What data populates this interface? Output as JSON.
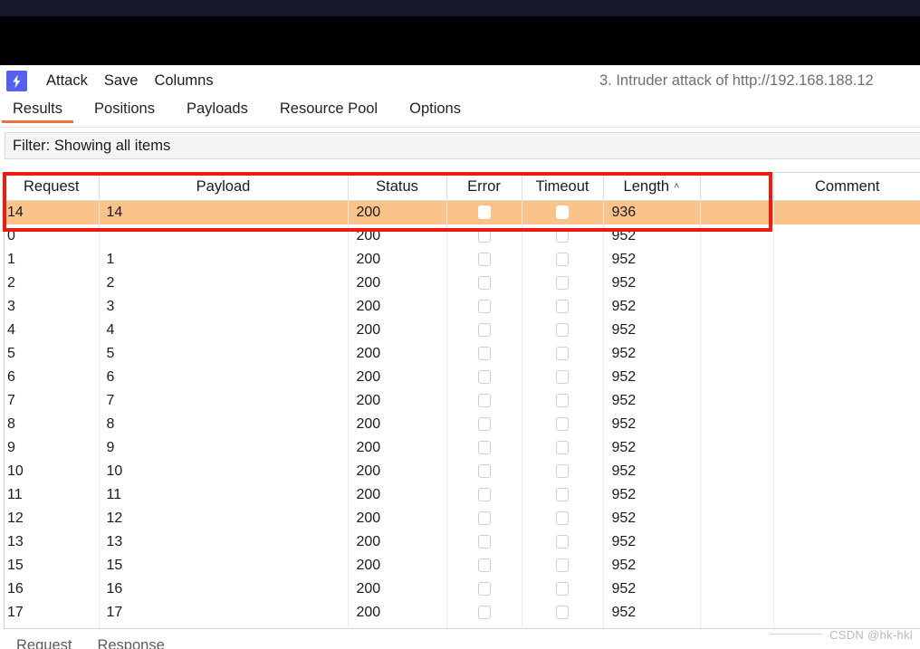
{
  "window": {
    "attack_title": "3. Intruder attack of http://192.168.188.12"
  },
  "menubar": {
    "logo_icon": "burp-lightning-icon",
    "items": [
      {
        "label": "Attack"
      },
      {
        "label": "Save"
      },
      {
        "label": "Columns"
      }
    ]
  },
  "tabs": [
    {
      "label": "Results",
      "active": true
    },
    {
      "label": "Positions",
      "active": false
    },
    {
      "label": "Payloads",
      "active": false
    },
    {
      "label": "Resource Pool",
      "active": false
    },
    {
      "label": "Options",
      "active": false
    }
  ],
  "filter": {
    "label": "Filter: Showing all items"
  },
  "table": {
    "columns": [
      {
        "key": "request",
        "label": "Request"
      },
      {
        "key": "payload",
        "label": "Payload"
      },
      {
        "key": "status",
        "label": "Status"
      },
      {
        "key": "error",
        "label": "Error"
      },
      {
        "key": "timeout",
        "label": "Timeout"
      },
      {
        "key": "length",
        "label": "Length",
        "sort": "ascending",
        "sort_caret": "˄"
      },
      {
        "key": "spacer",
        "label": ""
      },
      {
        "key": "comment",
        "label": "Comment"
      }
    ],
    "rows": [
      {
        "request": "14",
        "payload": "14",
        "status": "200",
        "error": false,
        "timeout": false,
        "length": "936",
        "comment": "",
        "highlighted": true
      },
      {
        "request": "0",
        "payload": "",
        "status": "200",
        "error": false,
        "timeout": false,
        "length": "952",
        "comment": "",
        "highlighted": false
      },
      {
        "request": "1",
        "payload": "1",
        "status": "200",
        "error": false,
        "timeout": false,
        "length": "952",
        "comment": "",
        "highlighted": false
      },
      {
        "request": "2",
        "payload": "2",
        "status": "200",
        "error": false,
        "timeout": false,
        "length": "952",
        "comment": "",
        "highlighted": false
      },
      {
        "request": "3",
        "payload": "3",
        "status": "200",
        "error": false,
        "timeout": false,
        "length": "952",
        "comment": "",
        "highlighted": false
      },
      {
        "request": "4",
        "payload": "4",
        "status": "200",
        "error": false,
        "timeout": false,
        "length": "952",
        "comment": "",
        "highlighted": false
      },
      {
        "request": "5",
        "payload": "5",
        "status": "200",
        "error": false,
        "timeout": false,
        "length": "952",
        "comment": "",
        "highlighted": false
      },
      {
        "request": "6",
        "payload": "6",
        "status": "200",
        "error": false,
        "timeout": false,
        "length": "952",
        "comment": "",
        "highlighted": false
      },
      {
        "request": "7",
        "payload": "7",
        "status": "200",
        "error": false,
        "timeout": false,
        "length": "952",
        "comment": "",
        "highlighted": false
      },
      {
        "request": "8",
        "payload": "8",
        "status": "200",
        "error": false,
        "timeout": false,
        "length": "952",
        "comment": "",
        "highlighted": false
      },
      {
        "request": "9",
        "payload": "9",
        "status": "200",
        "error": false,
        "timeout": false,
        "length": "952",
        "comment": "",
        "highlighted": false
      },
      {
        "request": "10",
        "payload": "10",
        "status": "200",
        "error": false,
        "timeout": false,
        "length": "952",
        "comment": "",
        "highlighted": false
      },
      {
        "request": "11",
        "payload": "11",
        "status": "200",
        "error": false,
        "timeout": false,
        "length": "952",
        "comment": "",
        "highlighted": false
      },
      {
        "request": "12",
        "payload": "12",
        "status": "200",
        "error": false,
        "timeout": false,
        "length": "952",
        "comment": "",
        "highlighted": false
      },
      {
        "request": "13",
        "payload": "13",
        "status": "200",
        "error": false,
        "timeout": false,
        "length": "952",
        "comment": "",
        "highlighted": false
      },
      {
        "request": "15",
        "payload": "15",
        "status": "200",
        "error": false,
        "timeout": false,
        "length": "952",
        "comment": "",
        "highlighted": false
      },
      {
        "request": "16",
        "payload": "16",
        "status": "200",
        "error": false,
        "timeout": false,
        "length": "952",
        "comment": "",
        "highlighted": false
      },
      {
        "request": "17",
        "payload": "17",
        "status": "200",
        "error": false,
        "timeout": false,
        "length": "952",
        "comment": "",
        "highlighted": false
      },
      {
        "request": "",
        "payload": "",
        "status": "",
        "error": false,
        "timeout": false,
        "length": "",
        "comment": "",
        "highlighted": false,
        "clipped": true
      }
    ]
  },
  "bottom_tabs": [
    {
      "label": "Request"
    },
    {
      "label": "Response"
    }
  ],
  "annotation": {
    "type": "red-rectangle-highlight",
    "color": "#ef1b12"
  },
  "watermark": {
    "text": "CSDN @hk-hkl"
  },
  "colors": {
    "accent_orange": "#e8743b",
    "row_highlight": "#fbc289",
    "logo_blue": "#5560f0",
    "annotation_red": "#ef1b12"
  }
}
